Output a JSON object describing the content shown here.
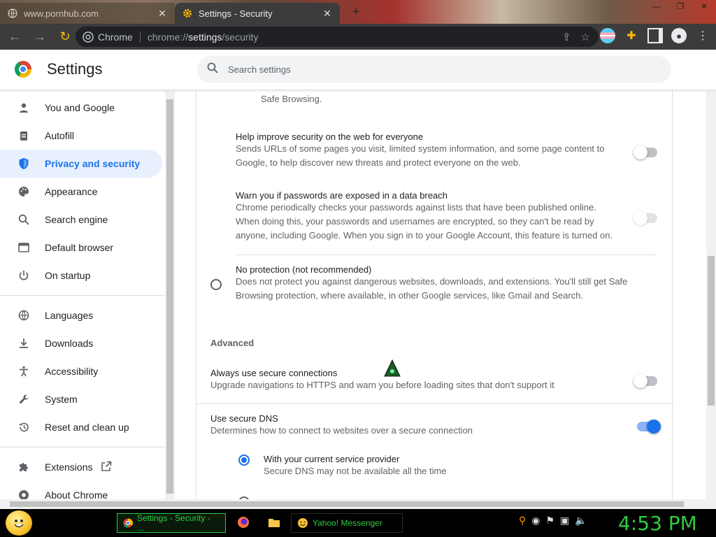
{
  "browser": {
    "inactive_tab": {
      "title": "www.pornhub.com"
    },
    "active_tab": {
      "title": "Settings - Security",
      "close": "✕"
    },
    "new_tab": "+",
    "omnibox": {
      "site_label": "Chrome",
      "url_prefix": "chrome://",
      "url_host": "settings",
      "url_path": "/security"
    }
  },
  "settings": {
    "title": "Settings",
    "search": {
      "placeholder": "Search settings"
    }
  },
  "sidebar": {
    "items": [
      {
        "label": "You and Google",
        "icon": "person-icon"
      },
      {
        "label": "Autofill",
        "icon": "clipboard-icon"
      },
      {
        "label": "Privacy and security",
        "icon": "shield-icon",
        "selected": true
      },
      {
        "label": "Appearance",
        "icon": "palette-icon"
      },
      {
        "label": "Search engine",
        "icon": "search-icon"
      },
      {
        "label": "Default browser",
        "icon": "browser-icon"
      },
      {
        "label": "On startup",
        "icon": "power-icon"
      },
      {
        "label": "Languages",
        "icon": "globe-icon"
      },
      {
        "label": "Downloads",
        "icon": "download-icon"
      },
      {
        "label": "Accessibility",
        "icon": "accessibility-icon"
      },
      {
        "label": "System",
        "icon": "wrench-icon"
      },
      {
        "label": "Reset and clean up",
        "icon": "history-icon"
      },
      {
        "label": "Extensions",
        "icon": "puzzle-icon"
      },
      {
        "label": "About Chrome",
        "icon": "chrome-icon"
      }
    ]
  },
  "main": {
    "truncated_line": "Safe Browsing.",
    "help_improve": {
      "title": "Help improve security on the web for everyone",
      "desc_line1": "Sends URLs of some pages you visit, limited system information, and some page content to",
      "desc_line2": "Google, to help discover new threats and protect everyone on the web.",
      "enabled": false
    },
    "password_breach": {
      "title": "Warn you if passwords are exposed in a data breach",
      "desc_line1": "Chrome periodically checks your passwords against lists that have been published online.",
      "desc_line2": "When doing this, your passwords and usernames are encrypted, so they can't be read by",
      "desc_line3": "anyone, including Google. When you sign in to your Google Account, this feature is turned on.",
      "enabled": false
    },
    "no_protection": {
      "title": "No protection (not recommended)",
      "desc_line1": "Does not protect you against dangerous websites, downloads, and extensions. You'll still get Safe",
      "desc_line2": "Browsing protection, where available, in other Google services, like Gmail and Search.",
      "selected": false
    },
    "advanced_title": "Advanced",
    "secure_connections": {
      "title": "Always use secure connections",
      "desc": "Upgrade navigations to HTTPS and warn you before loading sites that don't support it",
      "enabled": false
    },
    "secure_dns": {
      "title": "Use secure DNS",
      "desc": "Determines how to connect to websites over a secure connection",
      "enabled": true,
      "option_current": {
        "title": "With your current service provider",
        "desc": "Secure DNS may not be available all the time",
        "selected": true
      }
    }
  },
  "taskbar": {
    "active_task": "Settings - Security - ...",
    "yahoo_task": "Yahoo! Messenger",
    "clock": "4:53 PM"
  }
}
